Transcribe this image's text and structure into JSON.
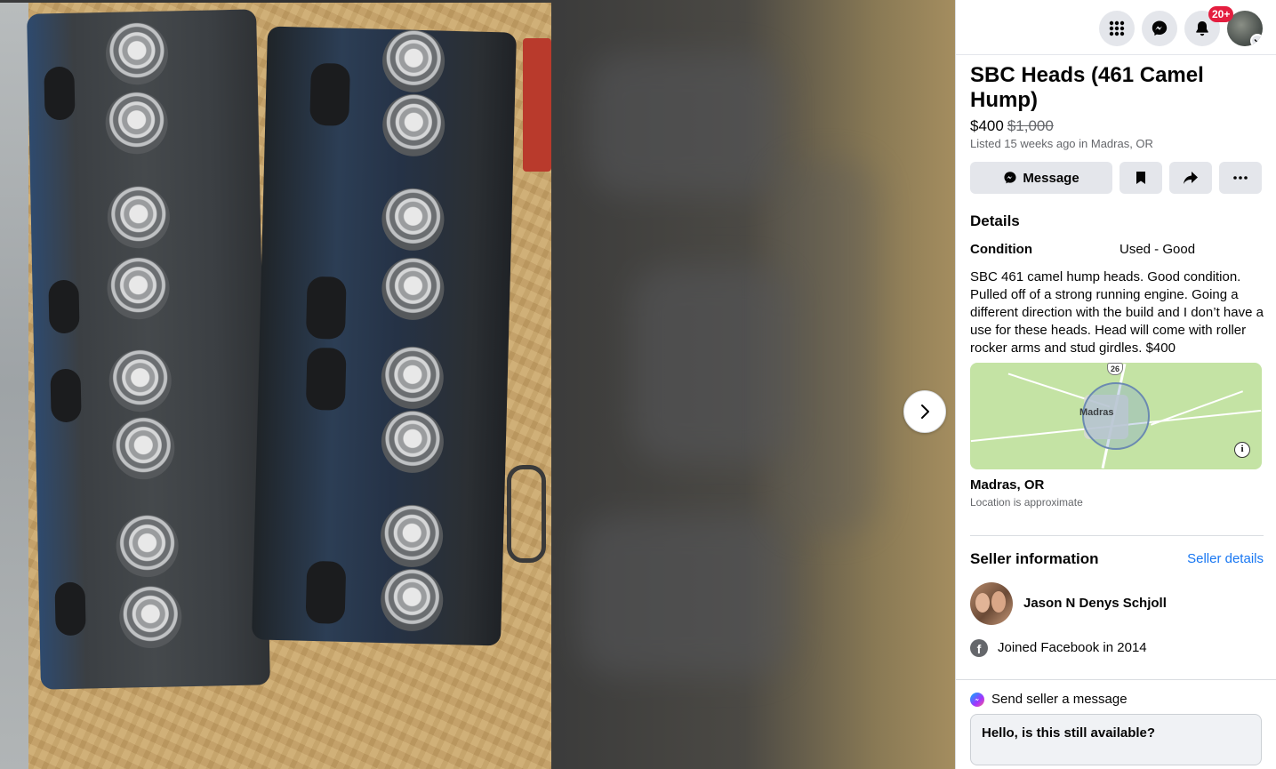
{
  "topbar": {
    "notification_count": "20+"
  },
  "listing": {
    "title": "SBC Heads (461 Camel Hump)",
    "price": "$400",
    "original_price": "$1,000",
    "listed": "Listed 15 weeks ago in Madras, OR",
    "actions": {
      "message_label": "Message"
    },
    "details_heading": "Details",
    "condition_label": "Condition",
    "condition_value": "Used - Good",
    "description": "SBC 461 camel hump heads. Good condition. Pulled off of a strong running engine. Going a different direction with the build and I don’t have a use for these heads. Head will come with roller rocker arms and stud girdles. $400",
    "map": {
      "town_label": "Madras",
      "route_shield": "26"
    },
    "location_name": "Madras, OR",
    "location_note": "Location is approximate"
  },
  "seller": {
    "heading": "Seller information",
    "details_link": "Seller details",
    "name": "Jason N Denys Schjoll",
    "joined": "Joined Facebook in 2014"
  },
  "send_message": {
    "heading": "Send seller a message",
    "default_text": "Hello, is this still available?"
  }
}
